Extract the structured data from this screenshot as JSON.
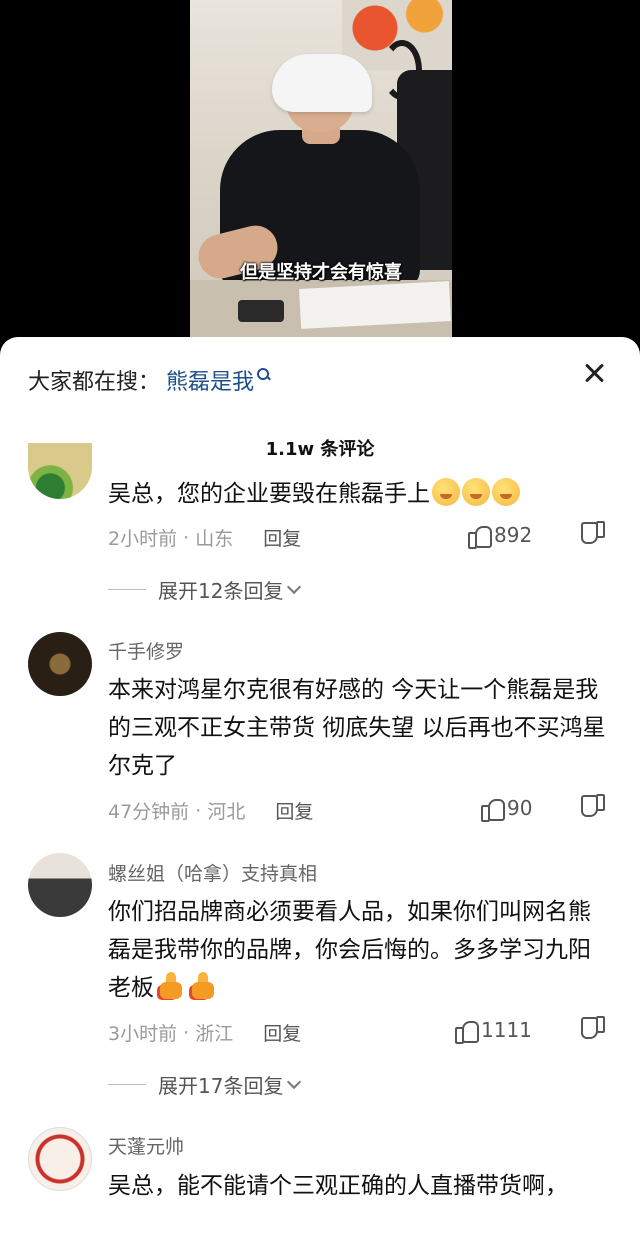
{
  "video": {
    "subtitle": "但是坚持才会有惊喜"
  },
  "sheet": {
    "search_prefix": "大家都在搜：",
    "search_term": "熊磊是我",
    "comment_count": "1.1w 条评论"
  },
  "comments": [
    {
      "username": "",
      "text": "吴总，您的企业要毁在熊磊手上",
      "emoji_count": 3,
      "time": "2小时前",
      "location": "山东",
      "reply_label": "回复",
      "likes": "892",
      "expand_label": "展开12条回复"
    },
    {
      "username": "千手修罗",
      "text": "本来对鸿星尔克很有好感的 今天让一个熊磊是我的三观不正女主带货 彻底失望 以后再也不买鸿星尔克了",
      "time": "47分钟前",
      "location": "河北",
      "reply_label": "回复",
      "likes": "90"
    },
    {
      "username": "螺丝姐（哈拿）支持真相",
      "text": "你们招品牌商必须要看人品，如果你们叫网名熊磊是我带你的品牌，你会后悔的。多多学习九阳老板",
      "time": "3小时前",
      "location": "浙江",
      "reply_label": "回复",
      "likes": "1111",
      "expand_label": "展开17条回复"
    },
    {
      "username": "天蓬元帅",
      "text": "吴总，能不能请个三观正确的人直播带货啊，"
    }
  ],
  "colors": {
    "link": "#1d4f8c",
    "meta": "#9a9a9a",
    "text": "#111111"
  }
}
